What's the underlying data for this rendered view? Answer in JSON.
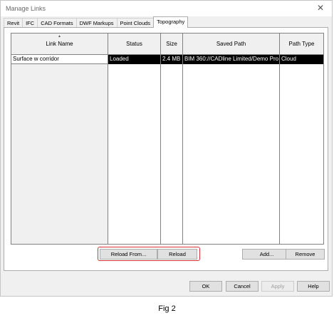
{
  "window": {
    "title": "Manage Links",
    "close_glyph": "✕"
  },
  "tabs": [
    {
      "label": "Revit",
      "active": false
    },
    {
      "label": "IFC",
      "active": false
    },
    {
      "label": "CAD Formats",
      "active": false
    },
    {
      "label": "DWF Markups",
      "active": false
    },
    {
      "label": "Point Clouds",
      "active": false
    },
    {
      "label": "Topography",
      "active": true
    }
  ],
  "table": {
    "columns": [
      "Link Name",
      "Status",
      "Size",
      "Saved Path",
      "Path Type"
    ],
    "sort_glyph": "▲",
    "rows": [
      {
        "link_name": "Surface w corridor",
        "status": "Loaded",
        "size": "2.4 MB",
        "saved_path": "BIM 360://CADline Limited/Demo Pro",
        "path_type": "Cloud"
      }
    ]
  },
  "panel_buttons": {
    "reload_from": "Reload From...",
    "reload": "Reload",
    "add": "Add...",
    "remove": "Remove"
  },
  "dialog_buttons": {
    "ok": "OK",
    "cancel": "Cancel",
    "apply": "Apply",
    "help": "Help"
  },
  "caption": "Fig 2",
  "colors": {
    "selection": "#000000",
    "highlight_box": "#d8323a"
  }
}
